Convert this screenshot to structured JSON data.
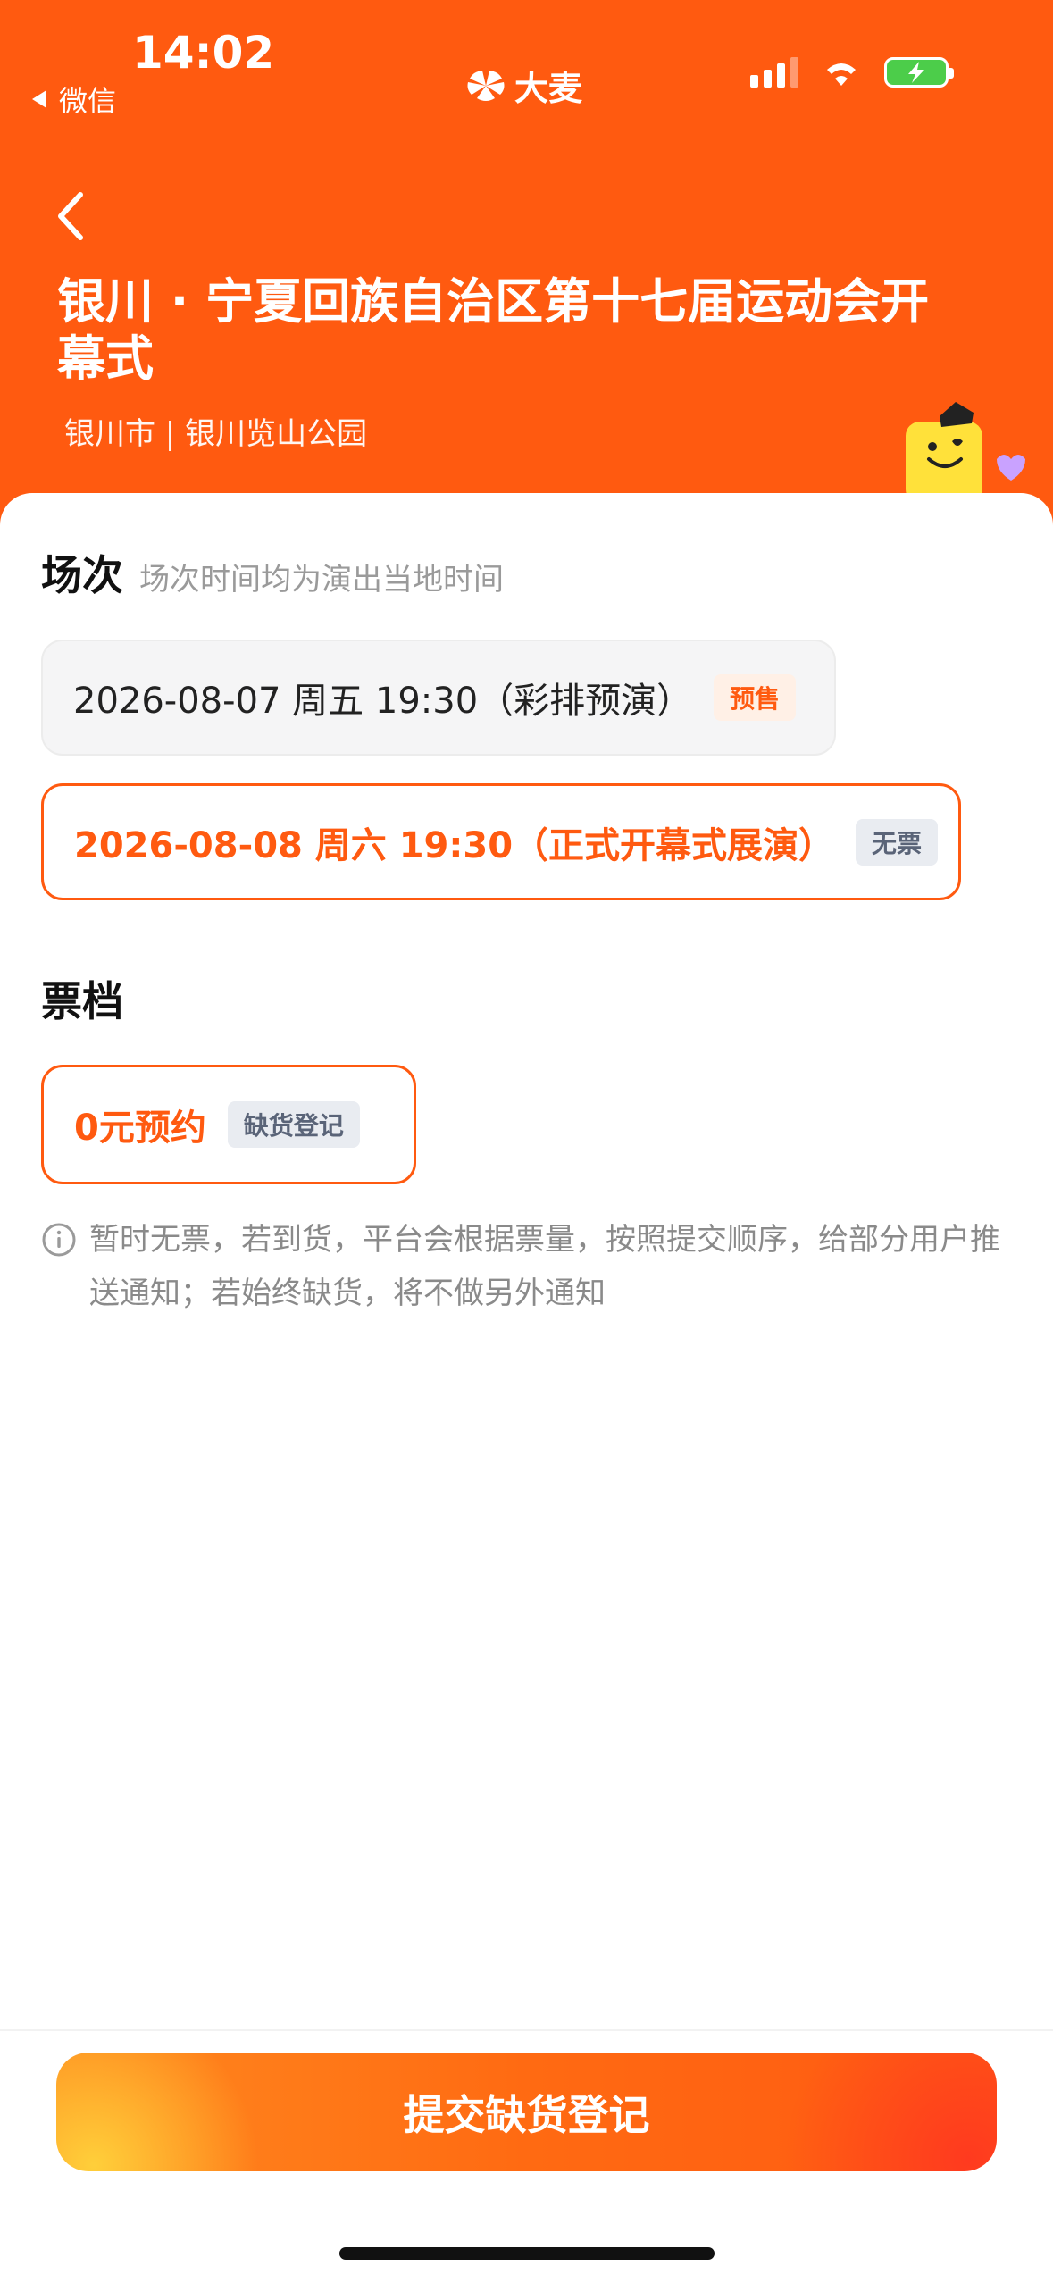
{
  "status_bar": {
    "time": "14:02",
    "back_app": "微信",
    "brand": "大麦"
  },
  "event": {
    "title": "银川 · 宁夏回族自治区第十七届运动会开幕式",
    "venue": "银川市 | 银川览山公园"
  },
  "sessions": {
    "title": "场次",
    "hint": "场次时间均为演出当地时间",
    "items": [
      {
        "label": "2026-08-07  周五 19:30（彩排预演）",
        "badge": "预售",
        "selected": false
      },
      {
        "label": "2026-08-08 周六 19:30（正式开幕式展演）",
        "badge": "无票",
        "selected": true
      }
    ]
  },
  "tiers": {
    "title": "票档",
    "items": [
      {
        "label": "0元预约",
        "badge": "缺货登记",
        "selected": true
      }
    ]
  },
  "notice": "暂时无票，若到货，平台会根据票量，按照提交顺序，给部分用户推送通知；若始终缺货，将不做另外通知",
  "submit_label": "提交缺货登记",
  "colors": {
    "accent": "#ff5a10",
    "header_bg": "#ff5a10",
    "muted_text": "#8a8a8a"
  }
}
